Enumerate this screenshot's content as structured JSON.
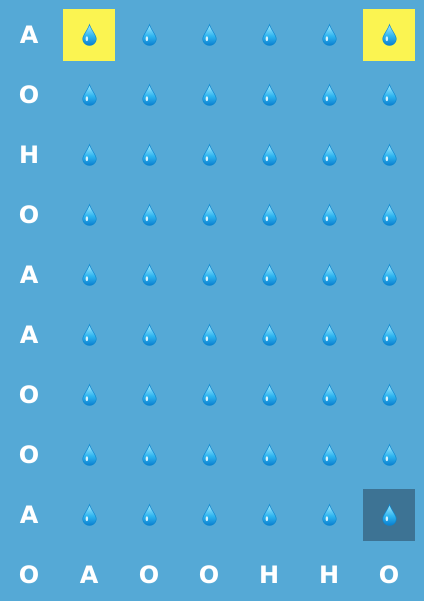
{
  "row_labels": [
    "A",
    "O",
    "H",
    "O",
    "A",
    "A",
    "O",
    "O",
    "A"
  ],
  "col_labels": [
    "O",
    "A",
    "O",
    "O",
    "H",
    "H",
    "O"
  ],
  "cell_icon": "water-drop-icon",
  "grid": {
    "rows": 9,
    "cols": 6
  },
  "highlights": [
    {
      "row": 0,
      "col": 0,
      "style": "yellow"
    },
    {
      "row": 0,
      "col": 5,
      "style": "yellow"
    },
    {
      "row": 8,
      "col": 5,
      "style": "dark"
    }
  ],
  "colors": {
    "background": "#55a9d6",
    "highlight_yellow": "#fbf451",
    "highlight_dark": "#3d7394",
    "label": "#ffffff",
    "drop_light": "#8fe3ff",
    "drop_dark": "#0a8fd8"
  }
}
